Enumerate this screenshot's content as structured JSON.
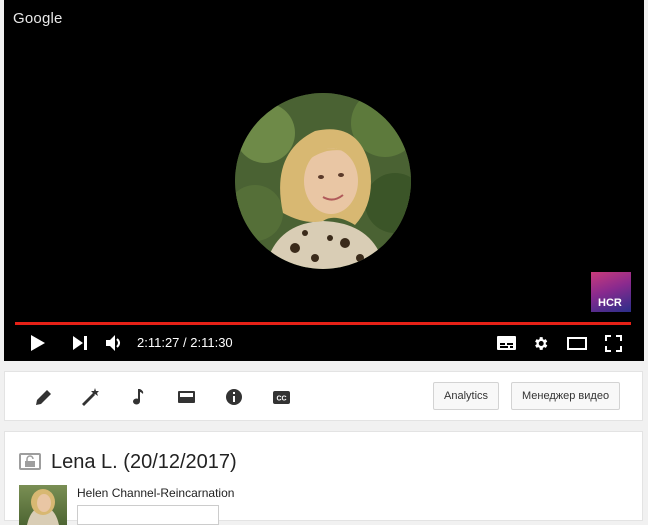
{
  "player": {
    "watermark": "Google",
    "channel_logo_text": "HCR",
    "time_display": "2:11:27 / 2:11:30",
    "progress_fraction": 0.9996,
    "colors": {
      "progress": "#e62117",
      "background": "#000000"
    },
    "icons": [
      "play-icon",
      "next-icon",
      "volume-icon",
      "subtitles-icon",
      "settings-gear-icon",
      "theater-mode-icon",
      "fullscreen-icon"
    ]
  },
  "toolbar": {
    "icons": [
      "pencil-icon",
      "magic-wand-icon",
      "music-note-icon",
      "end-screen-icon",
      "info-icon",
      "cc-icon"
    ],
    "analytics_label": "Analytics",
    "video_manager_label": "Менеджер видео"
  },
  "video": {
    "title": "Lena L. (20/12/2017)",
    "channel_name": "Helen Channel-Reincarnation"
  }
}
